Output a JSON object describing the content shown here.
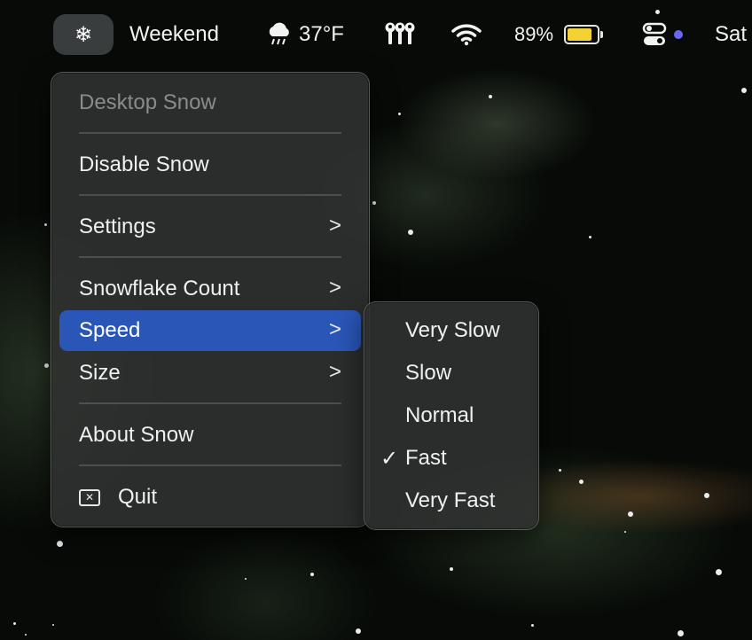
{
  "menubar": {
    "snow_icon": "snowflake-icon",
    "weekend_label": "Weekend",
    "weather_icon": "rain-cloud-icon",
    "temperature": "37°F",
    "tool_icon": "keys-icon",
    "wifi_icon": "wifi-icon",
    "battery_percent": "89%",
    "battery_level": 0.89,
    "control_center_icon": "control-center-icon",
    "day": "Sat"
  },
  "menu": {
    "header": "Desktop Snow",
    "items": [
      {
        "label": "Disable Snow"
      },
      {
        "label": "Settings",
        "submenu": true
      },
      {
        "label": "Snowflake Count",
        "submenu": true
      },
      {
        "label": "Speed",
        "submenu": true,
        "active": true
      },
      {
        "label": "Size",
        "submenu": true
      },
      {
        "label": "About Snow"
      },
      {
        "label": "Quit",
        "icon": "close-box-icon"
      }
    ]
  },
  "speed_submenu": {
    "options": [
      "Very Slow",
      "Slow",
      "Normal",
      "Fast",
      "Very Fast"
    ],
    "selected": "Fast"
  },
  "colors": {
    "accent": "#2a56b8",
    "battery": "#f5d234"
  }
}
